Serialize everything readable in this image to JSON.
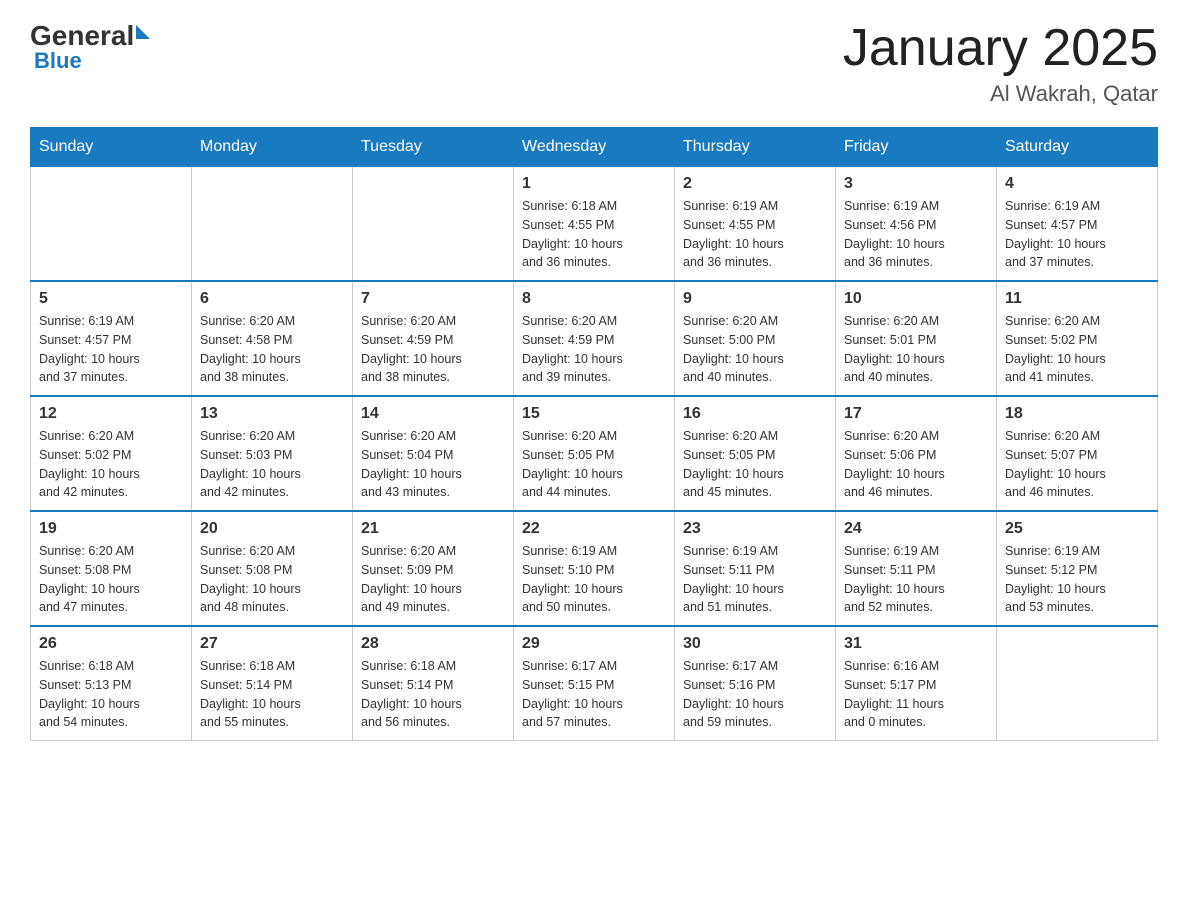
{
  "header": {
    "logo": {
      "general": "General",
      "blue": "Blue"
    },
    "title": "January 2025",
    "location": "Al Wakrah, Qatar"
  },
  "calendar": {
    "days_of_week": [
      "Sunday",
      "Monday",
      "Tuesday",
      "Wednesday",
      "Thursday",
      "Friday",
      "Saturday"
    ],
    "weeks": [
      [
        {
          "day": "",
          "info": ""
        },
        {
          "day": "",
          "info": ""
        },
        {
          "day": "",
          "info": ""
        },
        {
          "day": "1",
          "info": "Sunrise: 6:18 AM\nSunset: 4:55 PM\nDaylight: 10 hours\nand 36 minutes."
        },
        {
          "day": "2",
          "info": "Sunrise: 6:19 AM\nSunset: 4:55 PM\nDaylight: 10 hours\nand 36 minutes."
        },
        {
          "day": "3",
          "info": "Sunrise: 6:19 AM\nSunset: 4:56 PM\nDaylight: 10 hours\nand 36 minutes."
        },
        {
          "day": "4",
          "info": "Sunrise: 6:19 AM\nSunset: 4:57 PM\nDaylight: 10 hours\nand 37 minutes."
        }
      ],
      [
        {
          "day": "5",
          "info": "Sunrise: 6:19 AM\nSunset: 4:57 PM\nDaylight: 10 hours\nand 37 minutes."
        },
        {
          "day": "6",
          "info": "Sunrise: 6:20 AM\nSunset: 4:58 PM\nDaylight: 10 hours\nand 38 minutes."
        },
        {
          "day": "7",
          "info": "Sunrise: 6:20 AM\nSunset: 4:59 PM\nDaylight: 10 hours\nand 38 minutes."
        },
        {
          "day": "8",
          "info": "Sunrise: 6:20 AM\nSunset: 4:59 PM\nDaylight: 10 hours\nand 39 minutes."
        },
        {
          "day": "9",
          "info": "Sunrise: 6:20 AM\nSunset: 5:00 PM\nDaylight: 10 hours\nand 40 minutes."
        },
        {
          "day": "10",
          "info": "Sunrise: 6:20 AM\nSunset: 5:01 PM\nDaylight: 10 hours\nand 40 minutes."
        },
        {
          "day": "11",
          "info": "Sunrise: 6:20 AM\nSunset: 5:02 PM\nDaylight: 10 hours\nand 41 minutes."
        }
      ],
      [
        {
          "day": "12",
          "info": "Sunrise: 6:20 AM\nSunset: 5:02 PM\nDaylight: 10 hours\nand 42 minutes."
        },
        {
          "day": "13",
          "info": "Sunrise: 6:20 AM\nSunset: 5:03 PM\nDaylight: 10 hours\nand 42 minutes."
        },
        {
          "day": "14",
          "info": "Sunrise: 6:20 AM\nSunset: 5:04 PM\nDaylight: 10 hours\nand 43 minutes."
        },
        {
          "day": "15",
          "info": "Sunrise: 6:20 AM\nSunset: 5:05 PM\nDaylight: 10 hours\nand 44 minutes."
        },
        {
          "day": "16",
          "info": "Sunrise: 6:20 AM\nSunset: 5:05 PM\nDaylight: 10 hours\nand 45 minutes."
        },
        {
          "day": "17",
          "info": "Sunrise: 6:20 AM\nSunset: 5:06 PM\nDaylight: 10 hours\nand 46 minutes."
        },
        {
          "day": "18",
          "info": "Sunrise: 6:20 AM\nSunset: 5:07 PM\nDaylight: 10 hours\nand 46 minutes."
        }
      ],
      [
        {
          "day": "19",
          "info": "Sunrise: 6:20 AM\nSunset: 5:08 PM\nDaylight: 10 hours\nand 47 minutes."
        },
        {
          "day": "20",
          "info": "Sunrise: 6:20 AM\nSunset: 5:08 PM\nDaylight: 10 hours\nand 48 minutes."
        },
        {
          "day": "21",
          "info": "Sunrise: 6:20 AM\nSunset: 5:09 PM\nDaylight: 10 hours\nand 49 minutes."
        },
        {
          "day": "22",
          "info": "Sunrise: 6:19 AM\nSunset: 5:10 PM\nDaylight: 10 hours\nand 50 minutes."
        },
        {
          "day": "23",
          "info": "Sunrise: 6:19 AM\nSunset: 5:11 PM\nDaylight: 10 hours\nand 51 minutes."
        },
        {
          "day": "24",
          "info": "Sunrise: 6:19 AM\nSunset: 5:11 PM\nDaylight: 10 hours\nand 52 minutes."
        },
        {
          "day": "25",
          "info": "Sunrise: 6:19 AM\nSunset: 5:12 PM\nDaylight: 10 hours\nand 53 minutes."
        }
      ],
      [
        {
          "day": "26",
          "info": "Sunrise: 6:18 AM\nSunset: 5:13 PM\nDaylight: 10 hours\nand 54 minutes."
        },
        {
          "day": "27",
          "info": "Sunrise: 6:18 AM\nSunset: 5:14 PM\nDaylight: 10 hours\nand 55 minutes."
        },
        {
          "day": "28",
          "info": "Sunrise: 6:18 AM\nSunset: 5:14 PM\nDaylight: 10 hours\nand 56 minutes."
        },
        {
          "day": "29",
          "info": "Sunrise: 6:17 AM\nSunset: 5:15 PM\nDaylight: 10 hours\nand 57 minutes."
        },
        {
          "day": "30",
          "info": "Sunrise: 6:17 AM\nSunset: 5:16 PM\nDaylight: 10 hours\nand 59 minutes."
        },
        {
          "day": "31",
          "info": "Sunrise: 6:16 AM\nSunset: 5:17 PM\nDaylight: 11 hours\nand 0 minutes."
        },
        {
          "day": "",
          "info": ""
        }
      ]
    ]
  }
}
